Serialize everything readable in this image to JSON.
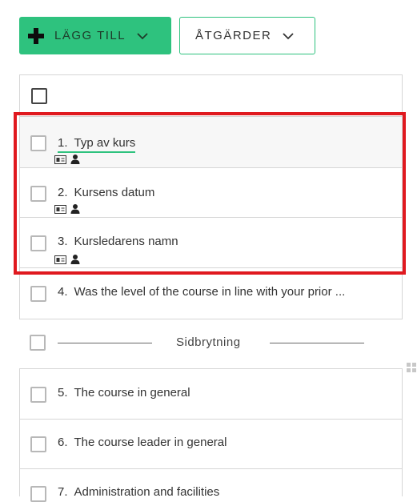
{
  "toolbar": {
    "add_label": "LÄGG TILL",
    "actions_label": "ÅTGÄRDER"
  },
  "colors": {
    "accent_green": "#2ec27e",
    "highlight_red": "#e0191f",
    "border_gray": "#d6d6d6"
  },
  "questions_top": [
    {
      "number": "1.",
      "text": "Typ av kurs",
      "icons": [
        "id-card-icon",
        "person-icon"
      ],
      "active": true
    },
    {
      "number": "2.",
      "text": "Kursens datum",
      "icons": [
        "id-card-icon",
        "person-icon"
      ]
    },
    {
      "number": "3.",
      "text": "Kursledarens namn",
      "icons": [
        "id-card-icon",
        "person-icon"
      ]
    },
    {
      "number": "4.",
      "text": "Was the level of the course in line with your prior ..."
    }
  ],
  "page_break": {
    "label": "Sidbrytning"
  },
  "questions_bottom": [
    {
      "number": "5.",
      "text": "The course in general"
    },
    {
      "number": "6.",
      "text": "The course leader in general"
    },
    {
      "number": "7.",
      "text": "Administration and facilities"
    }
  ]
}
